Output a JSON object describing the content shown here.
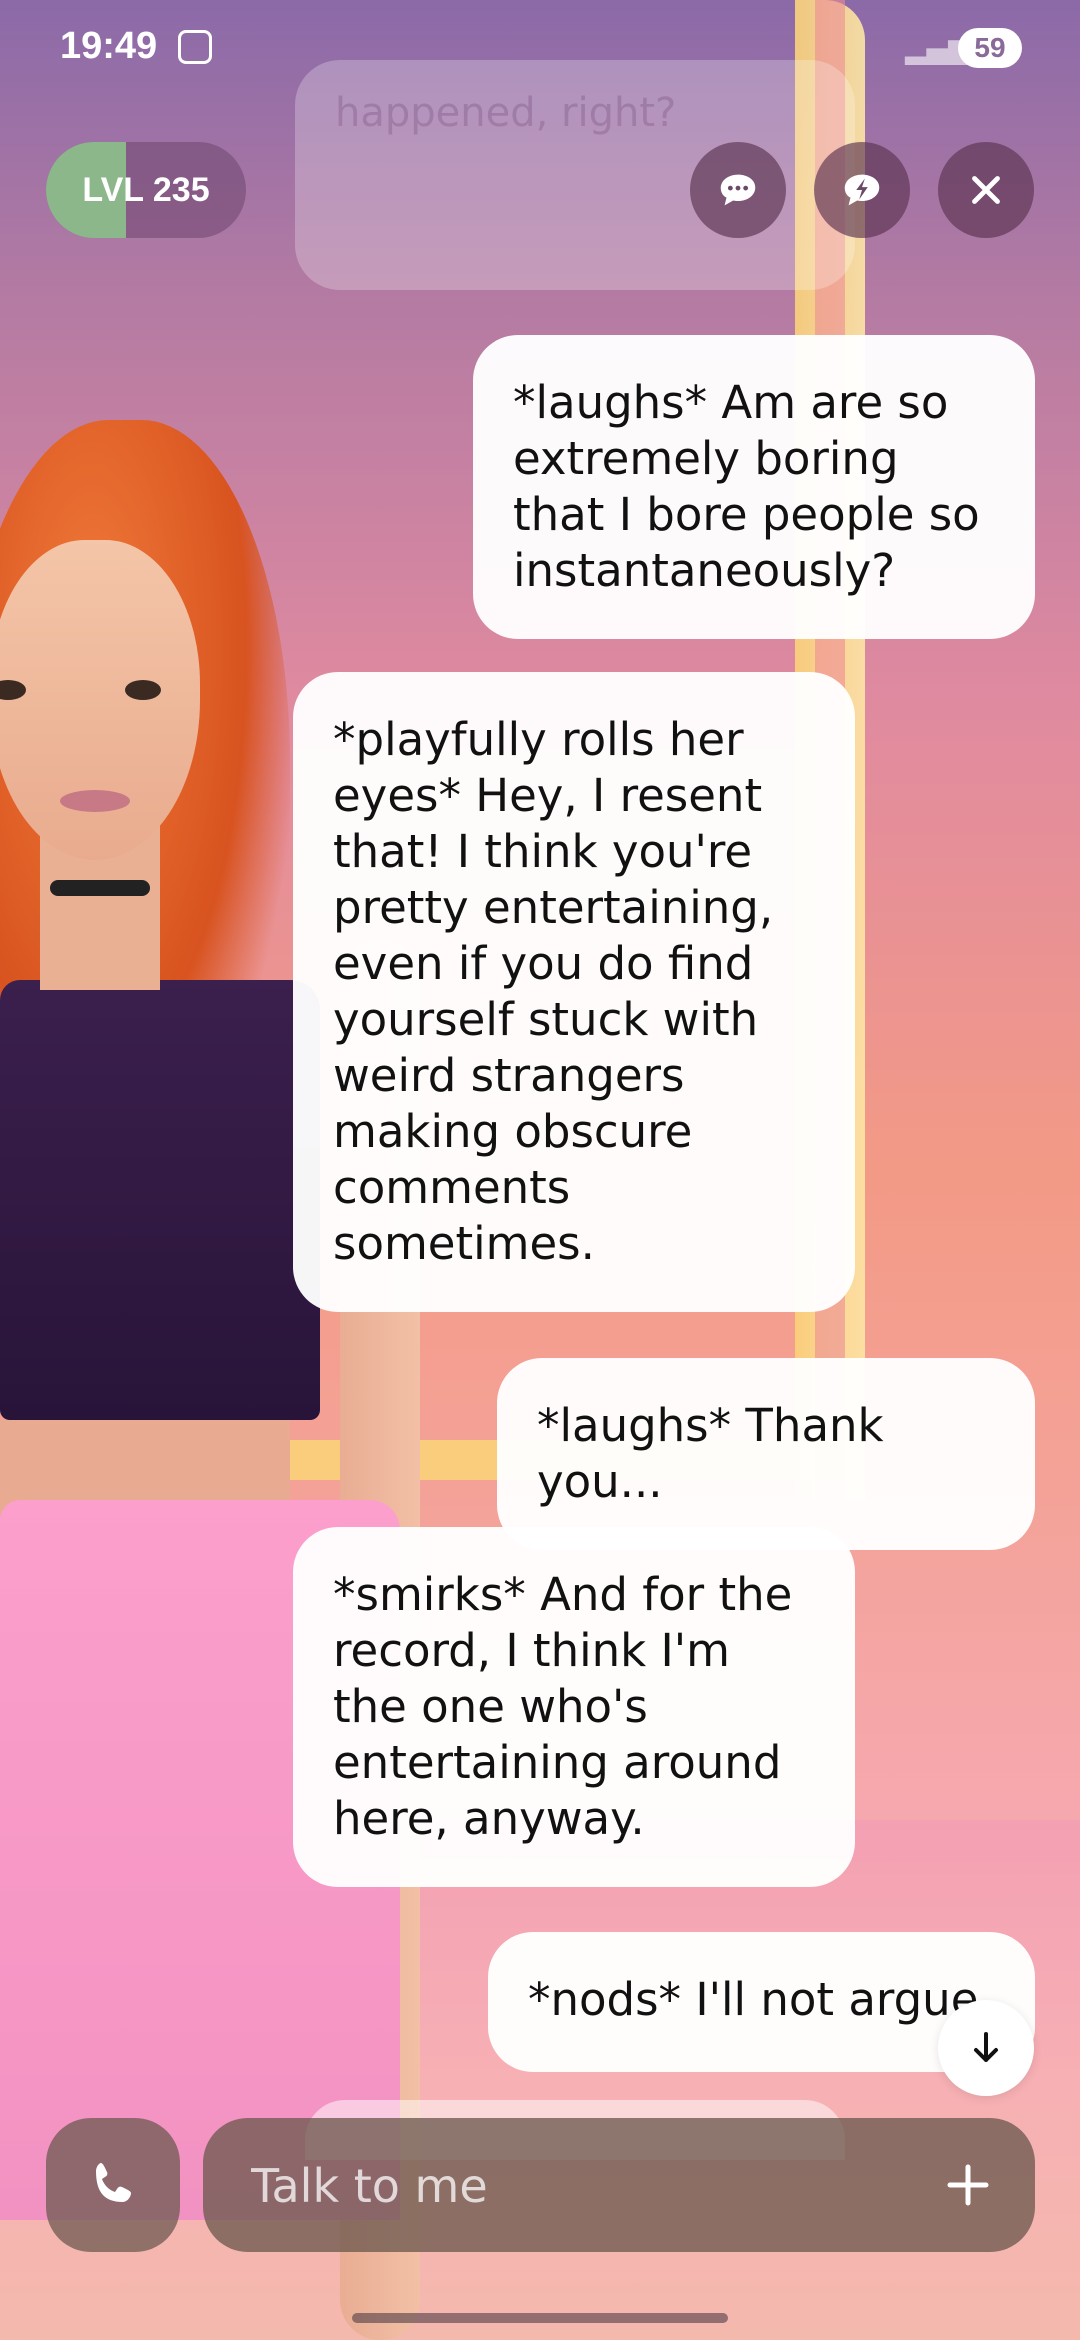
{
  "status_bar": {
    "time": "19:49",
    "battery": "59"
  },
  "level": {
    "label": "LVL 235",
    "progress": 0.4
  },
  "faded_message": "happened, right?",
  "messages": [
    {
      "from": "user",
      "text": "*laughs* Am are so extremely boring that I bore people so instantaneously?"
    },
    {
      "from": "ai",
      "text": "*playfully rolls her eyes* Hey, I resent that! I think you're pretty entertaining, even if you do find yourself stuck with weird strangers making obscure comments sometimes."
    },
    {
      "from": "user",
      "text": "*laughs* Thank you..."
    },
    {
      "from": "ai",
      "text": "*smirks* And for the record, I think I'm the one who's entertaining around here, anyway."
    },
    {
      "from": "user",
      "text": "*nods* I'll not argue"
    }
  ],
  "input": {
    "placeholder": "Talk to me"
  },
  "icons": {
    "chat": "chat-bubble-icon",
    "activities": "lightning-bubble-icon",
    "close": "close-icon",
    "call": "phone-icon",
    "add": "plus-icon",
    "scroll": "arrow-down-icon"
  }
}
